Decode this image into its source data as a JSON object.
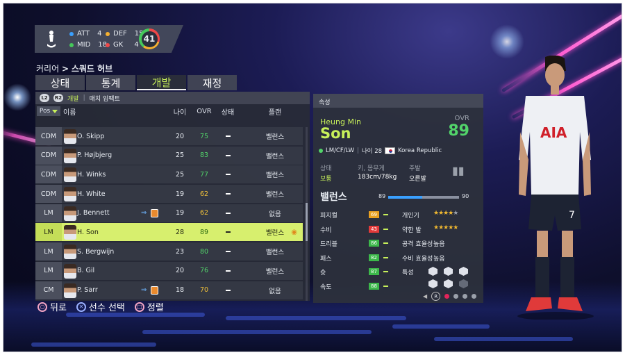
{
  "hud": {
    "att_label": "ATT",
    "att": "4",
    "def_label": "DEF",
    "def": "15",
    "mid_label": "MID",
    "mid": "18",
    "gk_label": "GK",
    "gk": "4",
    "rating": "41",
    "colors": {
      "att": "#3aa0ff",
      "def": "#f5b030",
      "mid": "#45c85a",
      "gk": "#f04848"
    }
  },
  "breadcrumb": {
    "root": "커리어",
    "sep": ">",
    "current": "스쿼드 허브"
  },
  "tabs": [
    {
      "label": "상태"
    },
    {
      "label": "통계"
    },
    {
      "label": "개발",
      "active": true
    },
    {
      "label": "재정"
    }
  ],
  "left": {
    "l2": "L2",
    "r2": "R2",
    "dev": "개발",
    "sep": "|",
    "match": "매치 임팩트",
    "headers": {
      "pos": "Pos",
      "name": "이름",
      "age": "나이",
      "ovr": "OVR",
      "status": "상태",
      "plan": "플랜"
    },
    "rows": [
      {
        "pos": "CDM",
        "name": "O. Skipp",
        "age": "20",
        "ovr": "75",
        "ovr_color": "green",
        "plan": "밸런스"
      },
      {
        "pos": "CDM",
        "name": "P. Højbjerg",
        "age": "25",
        "ovr": "83",
        "ovr_color": "green",
        "plan": "밸런스"
      },
      {
        "pos": "CDM",
        "name": "H. Winks",
        "age": "25",
        "ovr": "77",
        "ovr_color": "green",
        "plan": "밸런스"
      },
      {
        "pos": "CDM",
        "name": "H. White",
        "age": "19",
        "ovr": "62",
        "ovr_color": "yellow",
        "plan": "밸런스"
      },
      {
        "pos": "LM",
        "name": "J. Bennett",
        "age": "19",
        "ovr": "62",
        "ovr_color": "yellow",
        "plan": "없음",
        "transfer": "⇒"
      },
      {
        "pos": "LM",
        "name": "H. Son",
        "age": "28",
        "ovr": "89",
        "ovr_color": "green",
        "plan": "밸런스",
        "selected": true
      },
      {
        "pos": "LM",
        "name": "S. Bergwijn",
        "age": "23",
        "ovr": "80",
        "ovr_color": "green",
        "plan": "밸런스"
      },
      {
        "pos": "LM",
        "name": "B. Gil",
        "age": "20",
        "ovr": "76",
        "ovr_color": "green",
        "plan": "밸런스"
      },
      {
        "pos": "CM",
        "name": "P. Sarr",
        "age": "18",
        "ovr": "70",
        "ovr_color": "yellow",
        "plan": "없음",
        "transfer": "⇒"
      }
    ]
  },
  "right": {
    "header": "속성",
    "first_name": "Heung Min",
    "last_name": "Son",
    "ovr_label": "OVR",
    "ovr": "89",
    "positions": "LM/CF/LW",
    "age_label": "나이 28",
    "nation": "Korea Republic",
    "status_label": "상태",
    "status_value": "보통",
    "body_label": "키, 몸무게",
    "body_value": "183cm/78kg",
    "foot_label": "주발",
    "foot_value": "오른발",
    "balance_label": "밸런스",
    "balance_min": "89",
    "balance_max": "90",
    "balance_fraction": 0.48,
    "attrs": [
      {
        "label": "피지컬",
        "value": "69",
        "color": "#e9a020"
      },
      {
        "label": "수비",
        "value": "43",
        "color": "#e23a3a"
      },
      {
        "label": "드리블",
        "value": "86",
        "color": "#3cb84a"
      },
      {
        "label": "패스",
        "value": "82",
        "color": "#3cb84a"
      },
      {
        "label": "슛",
        "value": "87",
        "color": "#3cb84a"
      },
      {
        "label": "속도",
        "value": "88",
        "color": "#3cb84a"
      }
    ],
    "extras": [
      {
        "label": "개인기",
        "stars": 4
      },
      {
        "label": "약한 발",
        "stars": 5
      },
      {
        "label": "공격 효율성",
        "value": "높음"
      },
      {
        "label": "수비 효율성",
        "value": "높음"
      },
      {
        "label": "특성"
      }
    ],
    "pager": "R"
  },
  "footer": {
    "back": "뒤로",
    "select": "선수 선택",
    "sort": "정렬"
  }
}
